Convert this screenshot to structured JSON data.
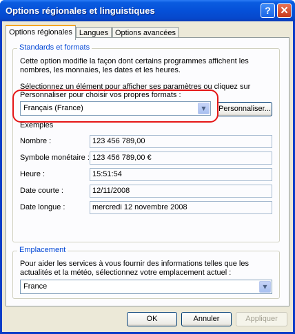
{
  "window": {
    "title": "Options régionales et linguistiques"
  },
  "titlebar_buttons": {
    "help": "?",
    "close": "✕"
  },
  "tabs": [
    {
      "label": "Options régionales",
      "active": true
    },
    {
      "label": "Langues",
      "active": false
    },
    {
      "label": "Options avancées",
      "active": false
    }
  ],
  "standards": {
    "group_label": "Standards et formats",
    "description": "Cette option modifie la façon dont certains programmes affichent les nombres, les monnaies, les dates et les heures.",
    "instruction_line1": "Sélectionnez un élément pour afficher ses paramètres ou cliquez sur",
    "instruction_line2": "Personnaliser pour choisir vos propres formats :",
    "locale_value": "Français (France)",
    "customize_button": "Personnaliser...",
    "examples_label": "Exemples",
    "examples": [
      {
        "label": "Nombre :",
        "value": "123 456 789,00"
      },
      {
        "label": "Symbole monétaire :",
        "value": "123 456 789,00 €"
      },
      {
        "label": "Heure :",
        "value": "15:51:54"
      },
      {
        "label": "Date courte :",
        "value": "12/11/2008"
      },
      {
        "label": "Date longue :",
        "value": "mercredi 12 novembre 2008"
      }
    ]
  },
  "location": {
    "group_label": "Emplacement",
    "description": "Pour aider les services à vous fournir des informations telles que les actualités et la météo, sélectionnez votre emplacement actuel :",
    "value": "France"
  },
  "buttons": {
    "ok": "OK",
    "cancel": "Annuler",
    "apply": "Appliquer"
  },
  "colors": {
    "accent": "#0046d5",
    "highlight": "#e51515",
    "titlebar": "#0550d8"
  }
}
